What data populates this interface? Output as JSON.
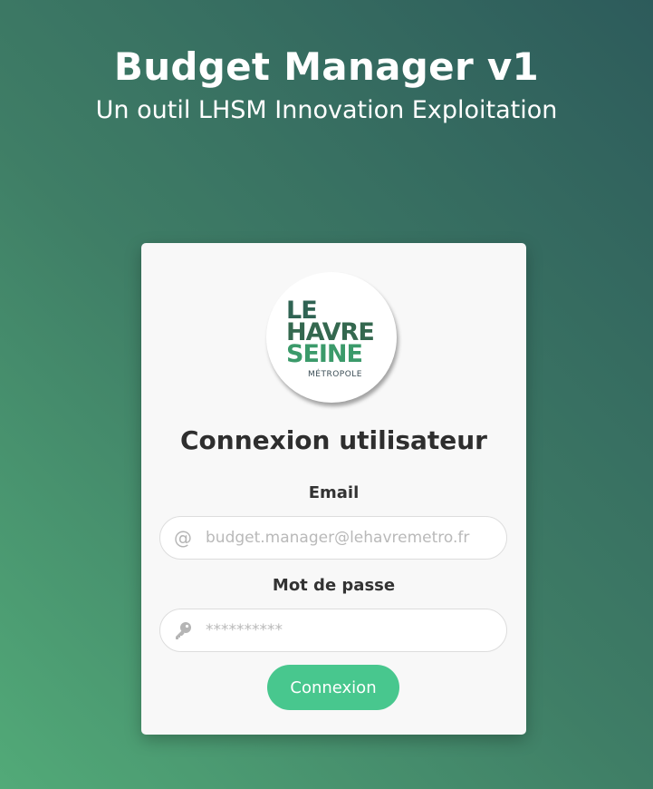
{
  "header": {
    "title": "Budget Manager v1",
    "subtitle": "Un outil LHSM Innovation Exploitation"
  },
  "logo": {
    "line1": "LE",
    "line2": "HAVRE",
    "line3": "SEINE",
    "subline": "MÉTROPOLE"
  },
  "login": {
    "title": "Connexion utilisateur",
    "email_label": "Email",
    "email_placeholder": "budget.manager@lehavremetro.fr",
    "email_icon": "at-icon",
    "password_label": "Mot de passe",
    "password_placeholder": "**********",
    "password_icon": "key-icon",
    "submit_label": "Connexion"
  },
  "colors": {
    "accent": "#48c78e",
    "background_from": "#52aa78",
    "background_to": "#2d5b5b",
    "card": "#f8f8f8"
  }
}
